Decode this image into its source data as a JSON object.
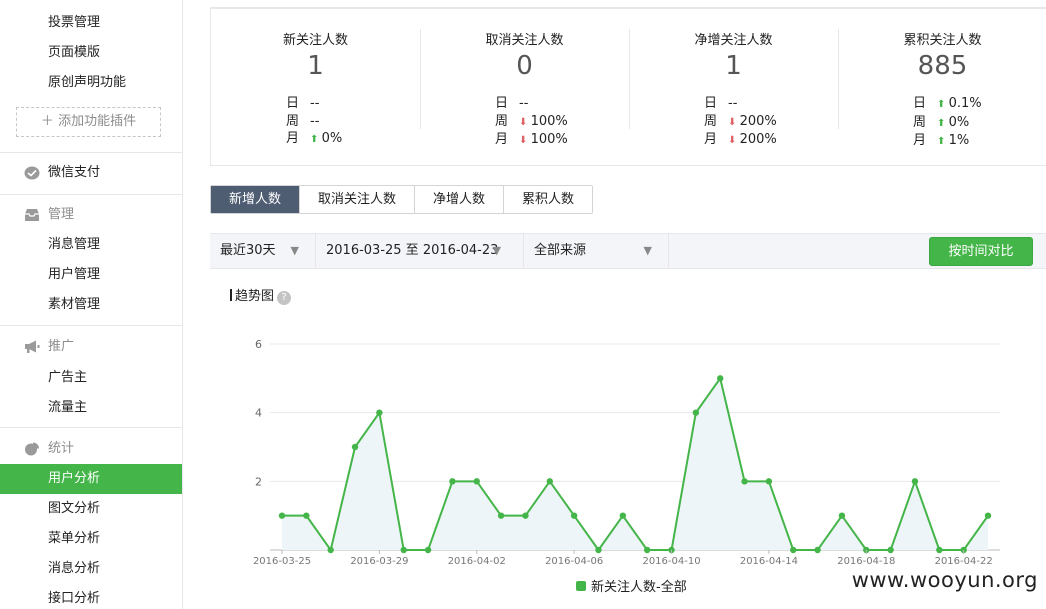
{
  "sidebar": {
    "top_items": [
      "投票管理",
      "页面模版",
      "原创声明功能"
    ],
    "add_plugin": "添加功能插件",
    "pay": "微信支付",
    "manage": {
      "head": "管理",
      "items": [
        "消息管理",
        "用户管理",
        "素材管理"
      ]
    },
    "promote": {
      "head": "推广",
      "items": [
        "广告主",
        "流量主"
      ]
    },
    "stats": {
      "head": "统计",
      "items": [
        "用户分析",
        "图文分析",
        "菜单分析",
        "消息分析",
        "接口分析"
      ],
      "active_index": 0
    }
  },
  "stats": [
    {
      "title": "新关注人数",
      "value": "1",
      "rows": [
        {
          "label": "日",
          "dir": "none",
          "value": "--"
        },
        {
          "label": "周",
          "dir": "none",
          "value": "--"
        },
        {
          "label": "月",
          "dir": "up",
          "value": "0%"
        }
      ]
    },
    {
      "title": "取消关注人数",
      "value": "0",
      "rows": [
        {
          "label": "日",
          "dir": "none",
          "value": "--"
        },
        {
          "label": "周",
          "dir": "down",
          "value": "100%"
        },
        {
          "label": "月",
          "dir": "down",
          "value": "100%"
        }
      ]
    },
    {
      "title": "净增关注人数",
      "value": "1",
      "rows": [
        {
          "label": "日",
          "dir": "none",
          "value": "--"
        },
        {
          "label": "周",
          "dir": "down",
          "value": "200%"
        },
        {
          "label": "月",
          "dir": "down",
          "value": "200%"
        }
      ]
    },
    {
      "title": "累积关注人数",
      "value": "885",
      "rows": [
        {
          "label": "日",
          "dir": "up",
          "value": "0.1%"
        },
        {
          "label": "周",
          "dir": "up",
          "value": "0%"
        },
        {
          "label": "月",
          "dir": "up",
          "value": "1%"
        }
      ]
    }
  ],
  "tabs": {
    "items": [
      "新增人数",
      "取消关注人数",
      "净增人数",
      "累积人数"
    ],
    "active_index": 0
  },
  "filters": {
    "period": "最近30天",
    "date_range": "2016-03-25 至 2016-04-23",
    "source": "全部来源",
    "compare_button": "按时间对比"
  },
  "chart_section": {
    "title": "趋势图",
    "help": "?"
  },
  "colors": {
    "accent": "#44b549",
    "tab_active": "#4f5d73",
    "down": "#e15f63"
  },
  "chart_data": {
    "type": "area",
    "x": [
      "2016-03-25",
      "2016-03-26",
      "2016-03-27",
      "2016-03-28",
      "2016-03-29",
      "2016-03-30",
      "2016-03-31",
      "2016-04-01",
      "2016-04-02",
      "2016-04-03",
      "2016-04-04",
      "2016-04-05",
      "2016-04-06",
      "2016-04-07",
      "2016-04-08",
      "2016-04-09",
      "2016-04-10",
      "2016-04-11",
      "2016-04-12",
      "2016-04-13",
      "2016-04-14",
      "2016-04-15",
      "2016-04-16",
      "2016-04-17",
      "2016-04-18",
      "2016-04-19",
      "2016-04-20",
      "2016-04-21",
      "2016-04-22",
      "2016-04-23"
    ],
    "x_tick_labels": [
      "2016-03-25",
      "2016-03-29",
      "2016-04-02",
      "2016-04-06",
      "2016-04-10",
      "2016-04-14",
      "2016-04-18",
      "2016-04-22"
    ],
    "series": [
      {
        "name": "新关注人数-全部",
        "values": [
          1,
          1,
          0,
          3,
          4,
          0,
          0,
          2,
          2,
          1,
          1,
          2,
          1,
          0,
          1,
          0,
          0,
          4,
          5,
          2,
          2,
          0,
          0,
          1,
          0,
          0,
          2,
          0,
          0,
          1
        ]
      }
    ],
    "ylim": [
      0,
      6
    ],
    "y_ticks": [
      2,
      4,
      6
    ],
    "legend": "bottom",
    "grid": true
  },
  "watermark": "www.wooyun.org"
}
